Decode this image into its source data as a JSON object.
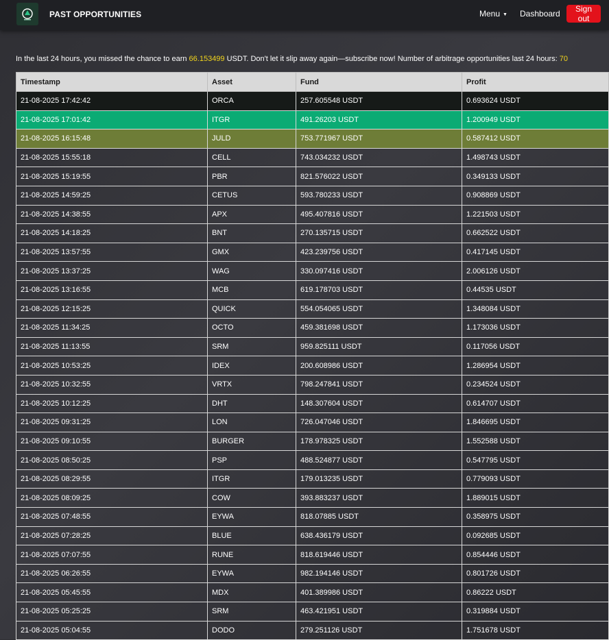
{
  "nav": {
    "brand": "PAST OPPORTUNITIES",
    "logo_caption": "⬡",
    "menu_label": "Menu",
    "caret": "▼",
    "dashboard_label": "Dashboard",
    "signout_label": "Sign out"
  },
  "banner": {
    "prefix": "In the last 24 hours, you missed the chance to earn ",
    "missed_amount": "66.153499",
    "middle": " USDT. Don't let it slip away again—subscribe now! Number of arbitrage opportunities last 24 hours: ",
    "opportunity_count": "70"
  },
  "colors": {
    "accent": "#f2d51d",
    "signout": "#e3121b",
    "row_green": "#0bab74",
    "row_olive": "#6e7d37",
    "row_dark": "#161a18"
  },
  "table": {
    "headers": [
      "Timestamp",
      "Asset",
      "Fund",
      "Profit"
    ],
    "rows": [
      {
        "timestamp": "21-08-2025 17:42:42",
        "asset": "ORCA",
        "fund": "257.605548 USDT",
        "profit": "0.693624 USDT",
        "highlight": "dark"
      },
      {
        "timestamp": "21-08-2025 17:01:42",
        "asset": "ITGR",
        "fund": "491.26203 USDT",
        "profit": "1.200949 USDT",
        "highlight": "green"
      },
      {
        "timestamp": "21-08-2025 16:15:48",
        "asset": "JULD",
        "fund": "753.771967 USDT",
        "profit": "0.587412 USDT",
        "highlight": "olive"
      },
      {
        "timestamp": "21-08-2025 15:55:18",
        "asset": "CELL",
        "fund": "743.034232 USDT",
        "profit": "1.498743 USDT",
        "highlight": ""
      },
      {
        "timestamp": "21-08-2025 15:19:55",
        "asset": "PBR",
        "fund": "821.576022 USDT",
        "profit": "0.349133 USDT",
        "highlight": ""
      },
      {
        "timestamp": "21-08-2025 14:59:25",
        "asset": "CETUS",
        "fund": "593.780233 USDT",
        "profit": "0.908869 USDT",
        "highlight": ""
      },
      {
        "timestamp": "21-08-2025 14:38:55",
        "asset": "APX",
        "fund": "495.407816 USDT",
        "profit": "1.221503 USDT",
        "highlight": ""
      },
      {
        "timestamp": "21-08-2025 14:18:25",
        "asset": "BNT",
        "fund": "270.135715 USDT",
        "profit": "0.662522 USDT",
        "highlight": ""
      },
      {
        "timestamp": "21-08-2025 13:57:55",
        "asset": "GMX",
        "fund": "423.239756 USDT",
        "profit": "0.417145 USDT",
        "highlight": ""
      },
      {
        "timestamp": "21-08-2025 13:37:25",
        "asset": "WAG",
        "fund": "330.097416 USDT",
        "profit": "2.006126 USDT",
        "highlight": ""
      },
      {
        "timestamp": "21-08-2025 13:16:55",
        "asset": "MCB",
        "fund": "619.178703 USDT",
        "profit": "0.44535 USDT",
        "highlight": ""
      },
      {
        "timestamp": "21-08-2025 12:15:25",
        "asset": "QUICK",
        "fund": "554.054065 USDT",
        "profit": "1.348084 USDT",
        "highlight": ""
      },
      {
        "timestamp": "21-08-2025 11:34:25",
        "asset": "OCTO",
        "fund": "459.381698 USDT",
        "profit": "1.173036 USDT",
        "highlight": ""
      },
      {
        "timestamp": "21-08-2025 11:13:55",
        "asset": "SRM",
        "fund": "959.825111 USDT",
        "profit": "0.117056 USDT",
        "highlight": ""
      },
      {
        "timestamp": "21-08-2025 10:53:25",
        "asset": "IDEX",
        "fund": "200.608986 USDT",
        "profit": "1.286954 USDT",
        "highlight": ""
      },
      {
        "timestamp": "21-08-2025 10:32:55",
        "asset": "VRTX",
        "fund": "798.247841 USDT",
        "profit": "0.234524 USDT",
        "highlight": ""
      },
      {
        "timestamp": "21-08-2025 10:12:25",
        "asset": "DHT",
        "fund": "148.307604 USDT",
        "profit": "0.614707 USDT",
        "highlight": ""
      },
      {
        "timestamp": "21-08-2025 09:31:25",
        "asset": "LON",
        "fund": "726.047046 USDT",
        "profit": "1.846695 USDT",
        "highlight": ""
      },
      {
        "timestamp": "21-08-2025 09:10:55",
        "asset": "BURGER",
        "fund": "178.978325 USDT",
        "profit": "1.552588 USDT",
        "highlight": ""
      },
      {
        "timestamp": "21-08-2025 08:50:25",
        "asset": "PSP",
        "fund": "488.524877 USDT",
        "profit": "0.547795 USDT",
        "highlight": ""
      },
      {
        "timestamp": "21-08-2025 08:29:55",
        "asset": "ITGR",
        "fund": "179.013235 USDT",
        "profit": "0.779093 USDT",
        "highlight": ""
      },
      {
        "timestamp": "21-08-2025 08:09:25",
        "asset": "COW",
        "fund": "393.883237 USDT",
        "profit": "1.889015 USDT",
        "highlight": ""
      },
      {
        "timestamp": "21-08-2025 07:48:55",
        "asset": "EYWA",
        "fund": "818.07885 USDT",
        "profit": "0.358975 USDT",
        "highlight": ""
      },
      {
        "timestamp": "21-08-2025 07:28:25",
        "asset": "BLUE",
        "fund": "638.436179 USDT",
        "profit": "0.092685 USDT",
        "highlight": ""
      },
      {
        "timestamp": "21-08-2025 07:07:55",
        "asset": "RUNE",
        "fund": "818.619446 USDT",
        "profit": "0.854446 USDT",
        "highlight": ""
      },
      {
        "timestamp": "21-08-2025 06:26:55",
        "asset": "EYWA",
        "fund": "982.194146 USDT",
        "profit": "0.801726 USDT",
        "highlight": ""
      },
      {
        "timestamp": "21-08-2025 05:45:55",
        "asset": "MDX",
        "fund": "401.389986 USDT",
        "profit": "0.86222 USDT",
        "highlight": ""
      },
      {
        "timestamp": "21-08-2025 05:25:25",
        "asset": "SRM",
        "fund": "463.421951 USDT",
        "profit": "0.319884 USDT",
        "highlight": ""
      },
      {
        "timestamp": "21-08-2025 05:04:55",
        "asset": "DODO",
        "fund": "279.251126 USDT",
        "profit": "1.751678 USDT",
        "highlight": ""
      }
    ]
  }
}
